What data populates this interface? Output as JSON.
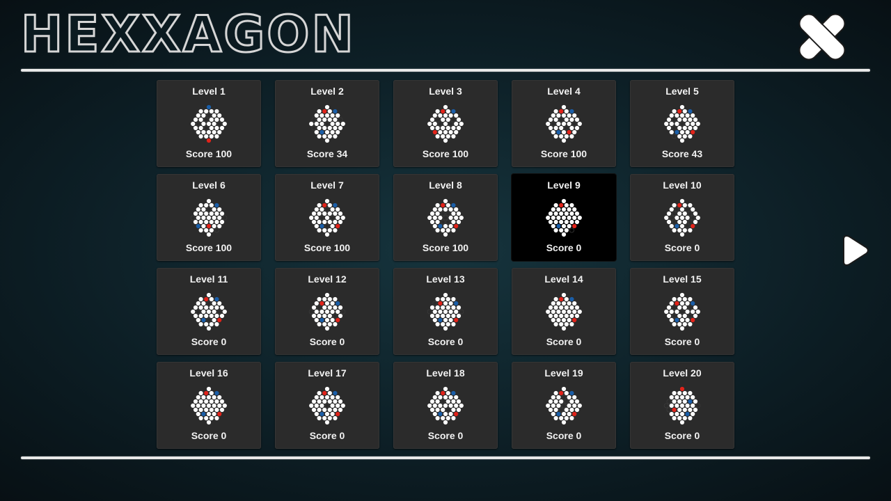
{
  "header": {
    "title": "HEXXAGON",
    "close_icon": "close-x-icon"
  },
  "navigation": {
    "next_icon": "play-arrow-right-icon"
  },
  "colors": {
    "peg": "#ffffff",
    "red_piece": "#e2231a",
    "blue_piece": "#1a5ea8",
    "hole": "#2b2b2b",
    "tile": "#2b2b2b",
    "tile_selected": "#000000"
  },
  "selected_level": 9,
  "levels": [
    {
      "title": "Level 1",
      "score": "Score 100"
    },
    {
      "title": "Level 2",
      "score": "Score 34"
    },
    {
      "title": "Level 3",
      "score": "Score 100"
    },
    {
      "title": "Level 4",
      "score": "Score 100"
    },
    {
      "title": "Level 5",
      "score": "Score 43"
    },
    {
      "title": "Level 6",
      "score": "Score 100"
    },
    {
      "title": "Level 7",
      "score": "Score 100"
    },
    {
      "title": "Level 8",
      "score": "Score 100"
    },
    {
      "title": "Level 9",
      "score": "Score 0"
    },
    {
      "title": "Level 10",
      "score": "Score 0"
    },
    {
      "title": "Level 11",
      "score": "Score 0"
    },
    {
      "title": "Level 12",
      "score": "Score 0"
    },
    {
      "title": "Level 13",
      "score": "Score 0"
    },
    {
      "title": "Level 14",
      "score": "Score 0"
    },
    {
      "title": "Level 15",
      "score": "Score 0"
    },
    {
      "title": "Level 16",
      "score": "Score 0"
    },
    {
      "title": "Level 17",
      "score": "Score 0"
    },
    {
      "title": "Level 18",
      "score": "Score 0"
    },
    {
      "title": "Level 19",
      "score": "Score 0"
    },
    {
      "title": "Level 20",
      "score": "Score 0"
    }
  ]
}
